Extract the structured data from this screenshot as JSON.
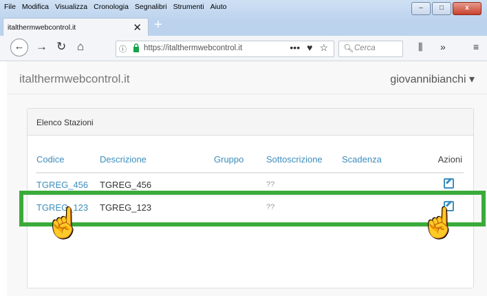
{
  "menu": [
    "File",
    "Modifica",
    "Visualizza",
    "Cronologia",
    "Segnalibri",
    "Strumenti",
    "Aiuto"
  ],
  "tab": {
    "title": "italthermwebcontrol.it",
    "close": "✕"
  },
  "newtab": "+",
  "url": {
    "text": "https://italthermwebcontrol.it",
    "info": "ⓘ"
  },
  "search": {
    "placeholder": "Cerca"
  },
  "toolbar": {
    "more": "•••",
    "pocket": "♥",
    "star": "☆",
    "library": "⫼",
    "overflow": "»",
    "menu": "≡"
  },
  "winbuttons": {
    "min": "–",
    "max": "□",
    "close": "x"
  },
  "app": {
    "brand": "italthermwebcontrol.it",
    "user": "giovannibianchi ▾"
  },
  "panel": {
    "title": "Elenco Stazioni",
    "columns": [
      "Codice",
      "Descrizione",
      "Gruppo",
      "Sottoscrizione",
      "Scadenza",
      "Azioni"
    ],
    "rows": [
      {
        "codice": "TGREG_456",
        "descrizione": "TGREG_456",
        "gruppo": "",
        "sottoscrizione": "??",
        "scadenza": ""
      },
      {
        "codice": "TGREG_123",
        "descrizione": "TGREG_123",
        "gruppo": "",
        "sottoscrizione": "??",
        "scadenza": ""
      }
    ]
  },
  "colors": {
    "link": "#3c8dbc",
    "highlight": "#3aab3a"
  }
}
